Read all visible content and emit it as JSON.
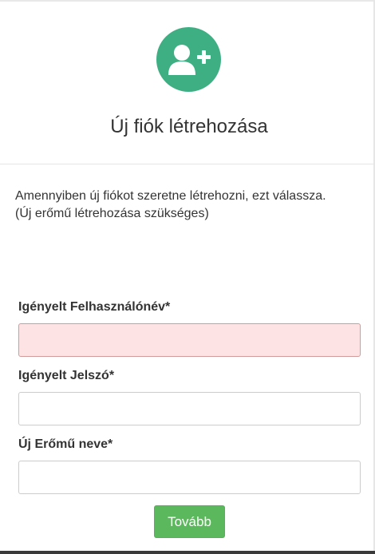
{
  "header": {
    "icon": "add-user-icon",
    "title": "Új fiók létrehozása",
    "accent_color": "#3daf83"
  },
  "description": {
    "line1": "Amennyiben új fiókot szeretne létrehozni, ezt válassza.",
    "line2": "(Új erőmű létrehozása szükséges)"
  },
  "form": {
    "username": {
      "label": "Igényelt Felhasználónév*",
      "value": "",
      "state": "invalid",
      "invalid_color": "#fde3e3"
    },
    "password": {
      "label": "Igényelt Jelszó*",
      "value": ""
    },
    "plant_name": {
      "label": "Új Erőmű neve*",
      "value": ""
    },
    "submit": {
      "label": "Tovább",
      "color": "#5cb85c"
    }
  }
}
